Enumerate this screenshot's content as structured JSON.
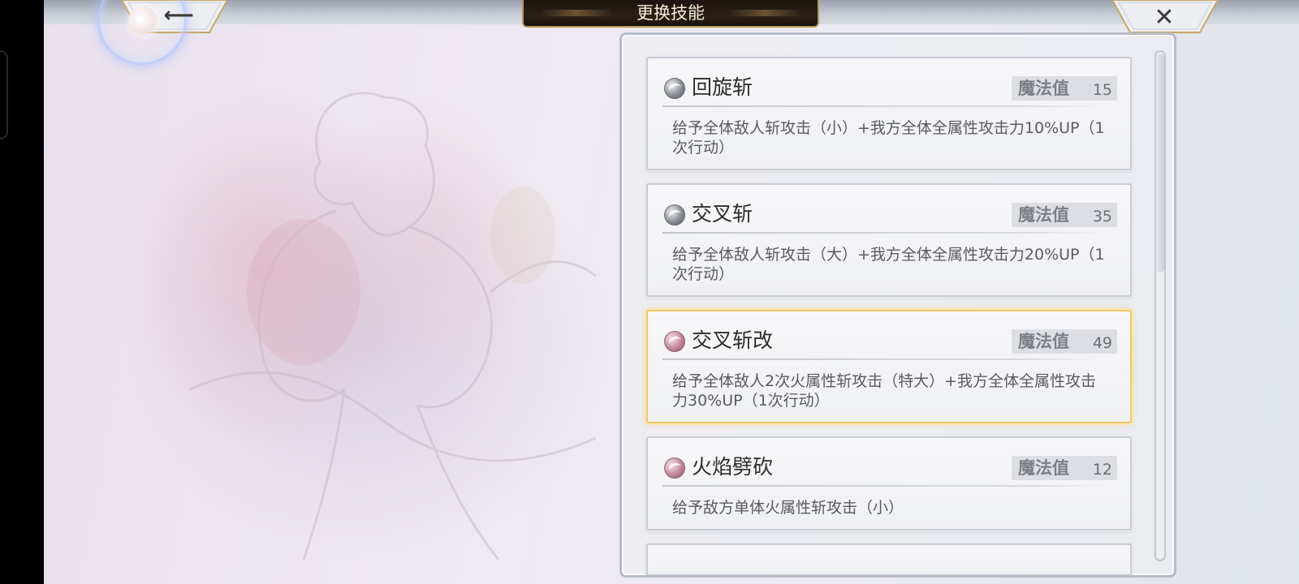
{
  "header": {
    "title": "更换技能",
    "back_icon": "back-arrow-icon",
    "close_icon": "close-x-icon"
  },
  "skills": [
    {
      "name": "回旋斩",
      "mp_label": "魔法值",
      "mp_value": "15",
      "description": "给予全体敌人斩攻击（小）+我方全体全属性攻击力10%UP（1次行动）",
      "icon": "slash-skill-icon",
      "selected": false
    },
    {
      "name": "交叉斩",
      "mp_label": "魔法值",
      "mp_value": "35",
      "description": "给予全体敌人斩攻击（大）+我方全体全属性攻击力20%UP（1次行动）",
      "icon": "slash-skill-icon",
      "selected": false
    },
    {
      "name": "交叉斩改",
      "mp_label": "魔法值",
      "mp_value": "49",
      "description": "给予全体敌人2次火属性斩攻击（特大）+我方全体全属性攻击力30%UP（1次行动）",
      "icon": "fire-slash-skill-icon",
      "selected": true
    },
    {
      "name": "火焰劈砍",
      "mp_label": "魔法值",
      "mp_value": "12",
      "description": "给予敌方单体火属性斩攻击（小）",
      "icon": "fire-slash-skill-icon",
      "selected": false
    }
  ],
  "colors": {
    "selected_border": "#f1c768",
    "title_plate": "#2a2016",
    "title_trim": "#b9975a"
  }
}
